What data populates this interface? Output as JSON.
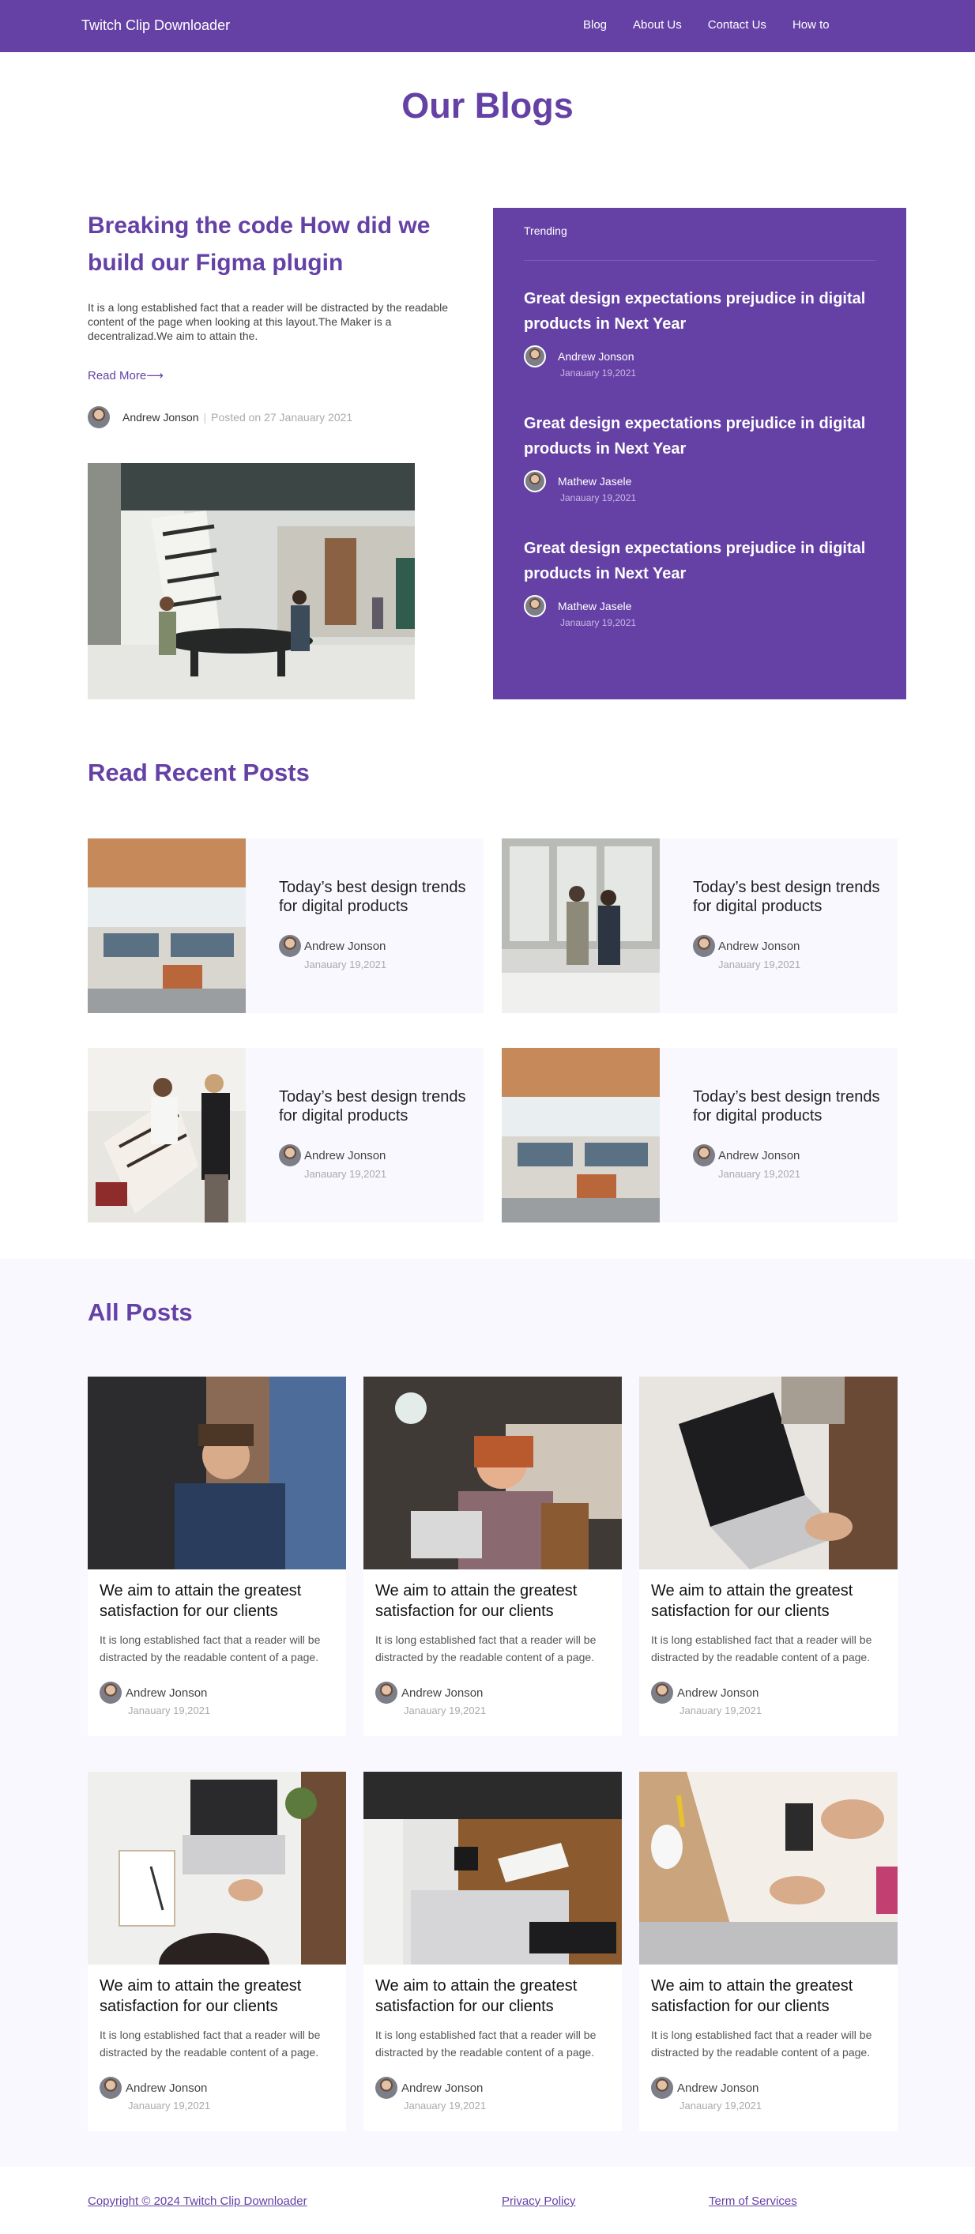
{
  "nav": {
    "brand": "Twitch Clip Downloader",
    "links": [
      "Blog",
      "About Us",
      "Contact Us",
      "How to"
    ]
  },
  "page_title": "Our Blogs",
  "hero": {
    "title": "Breaking the code How did we build our Figma plugin",
    "text": "It is a long established fact that a reader will be distracted by the readable content of the page when looking at this layout.The Maker is a decentralizad.We aim to attain the.",
    "read_more": "Read More⟶",
    "author": "Andrew Jonson",
    "separator": "|",
    "posted": "Posted on 27 Janauary 2021"
  },
  "trending": {
    "label": "Trending",
    "items": [
      {
        "title": "Great design expectations prejudice in digital products in Next Year",
        "author": "Andrew Jonson",
        "date": "Janauary 19,2021"
      },
      {
        "title": "Great design expectations prejudice in digital products in Next Year",
        "author": "Mathew Jasele",
        "date": "Janauary 19,2021"
      },
      {
        "title": "Great design expectations prejudice in digital products in Next Year",
        "author": "Mathew Jasele",
        "date": "Janauary 19,2021"
      }
    ]
  },
  "recent": {
    "title": "Read Recent Posts",
    "posts": [
      {
        "title": "Today’s best design trends for digital products",
        "author": "Andrew Jonson",
        "date": "Janauary 19,2021"
      },
      {
        "title": "Today’s best design trends for digital products",
        "author": "Andrew Jonson",
        "date": "Janauary 19,2021"
      },
      {
        "title": "Today’s best design trends for digital products",
        "author": "Andrew Jonson",
        "date": "Janauary 19,2021"
      },
      {
        "title": "Today’s best design trends for digital products",
        "author": "Andrew Jonson",
        "date": "Janauary 19,2021"
      }
    ]
  },
  "all_posts": {
    "title": "All Posts",
    "posts": [
      {
        "title": "We aim to attain the greatest satisfaction for our clients",
        "text": "It is long established fact that a reader will be distracted by the readable content of a page.",
        "author": "Andrew Jonson",
        "date": "Janauary 19,2021"
      },
      {
        "title": "We aim to attain the greatest satisfaction for our clients",
        "text": "It is long established fact that a reader will be distracted by the readable content of a page.",
        "author": "Andrew Jonson",
        "date": "Janauary 19,2021"
      },
      {
        "title": "We aim to attain the greatest satisfaction for our clients",
        "text": "It is long established fact that a reader will be distracted by the readable content of a page.",
        "author": "Andrew Jonson",
        "date": "Janauary 19,2021"
      },
      {
        "title": "We aim to attain the greatest satisfaction for our clients",
        "text": "It is long established fact that a reader will be distracted by the readable content of a page.",
        "author": "Andrew Jonson",
        "date": "Janauary 19,2021"
      },
      {
        "title": "We aim to attain the greatest satisfaction for our clients",
        "text": "It is long established fact that a reader will be distracted by the readable content of a page.",
        "author": "Andrew Jonson",
        "date": "Janauary 19,2021"
      },
      {
        "title": "We aim to attain the greatest satisfaction for our clients",
        "text": "It is long established fact that a reader will be distracted by the readable content of a page.",
        "author": "Andrew Jonson",
        "date": "Janauary 19,2021"
      }
    ]
  },
  "footer": {
    "copyright": "Copyright © 2024 Twitch Clip Downloader",
    "privacy": "Privacy Policy",
    "terms": "Term of Services"
  },
  "colors": {
    "brand_purple": "#6541a5",
    "soft_background": "#f9f8fe"
  }
}
